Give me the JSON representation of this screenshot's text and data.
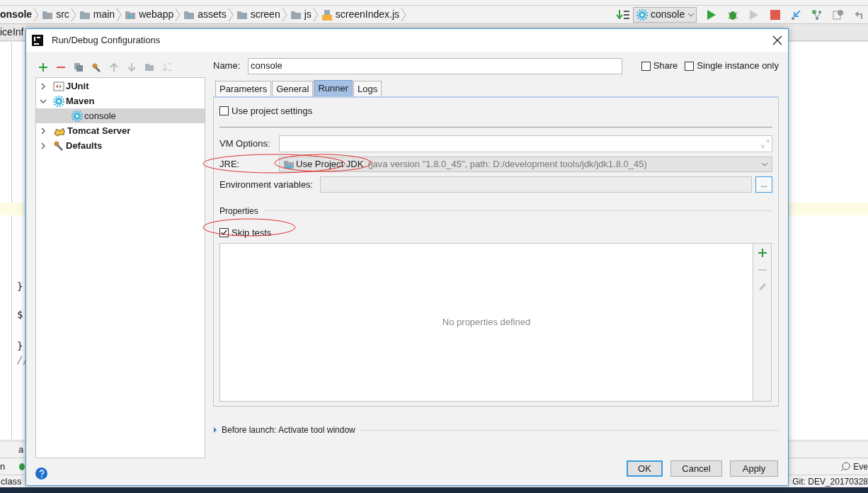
{
  "ide": {
    "breadcrumbs": [
      {
        "label": "onsole",
        "kind": "project"
      },
      {
        "label": "src",
        "kind": "folder"
      },
      {
        "label": "main",
        "kind": "folder"
      },
      {
        "label": "webapp",
        "kind": "module"
      },
      {
        "label": "assets",
        "kind": "folder"
      },
      {
        "label": "screen",
        "kind": "folder"
      },
      {
        "label": "js",
        "kind": "folder"
      },
      {
        "label": "screenIndex.js",
        "kind": "file"
      }
    ],
    "run_config": "console",
    "editor_tab": "iceInf",
    "code_lines": [
      {
        "text": "}"
      },
      {
        "text": "$"
      },
      {
        "text": "}"
      },
      {
        "text": "//"
      }
    ],
    "bottom_left": [
      "a",
      "n",
      "class"
    ],
    "event_log": "Eve",
    "git_branch": "Git: DEV_20170328"
  },
  "dialog": {
    "title": "Run/Debug Configurations",
    "tree": [
      {
        "label": "JUnit",
        "kind": "junit",
        "expanded": false,
        "selected": false
      },
      {
        "label": "Maven",
        "kind": "maven",
        "expanded": true,
        "selected": false,
        "children": [
          {
            "label": "console",
            "kind": "maven",
            "selected": true
          }
        ]
      },
      {
        "label": "Tomcat Server",
        "kind": "tomcat",
        "expanded": false,
        "selected": false
      },
      {
        "label": "Defaults",
        "kind": "defaults",
        "expanded": false,
        "selected": false
      }
    ],
    "name_label": "Name:",
    "name_value": "console",
    "share": {
      "label": "Share",
      "checked": false
    },
    "single_instance": {
      "label": "Single instance only",
      "checked": false
    },
    "tabs": [
      {
        "label": "Parameters",
        "selected": false
      },
      {
        "label": "General",
        "selected": false
      },
      {
        "label": "Runner",
        "selected": true
      },
      {
        "label": "Logs",
        "selected": false
      }
    ],
    "use_project_settings": {
      "label": "Use project settings",
      "checked": false
    },
    "vm_options_label": "VM Options:",
    "jre_label": "JRE:",
    "jre_value": "Use Project JDK",
    "jre_detail": "(java version \"1.8.0_45\", path: D:/development tools/jdk/jdk1.8.0_45)",
    "env_label": "Environment variables:",
    "env_button": "...",
    "properties_heading": "Properties",
    "skip_tests": {
      "label": "Skip tests",
      "checked": true
    },
    "properties_empty": "No properties defined",
    "before_launch": "Before launch: Activate tool window",
    "buttons": [
      {
        "label": "OK",
        "default": true
      },
      {
        "label": "Cancel",
        "default": false
      },
      {
        "label": "Apply",
        "default": false
      }
    ]
  }
}
